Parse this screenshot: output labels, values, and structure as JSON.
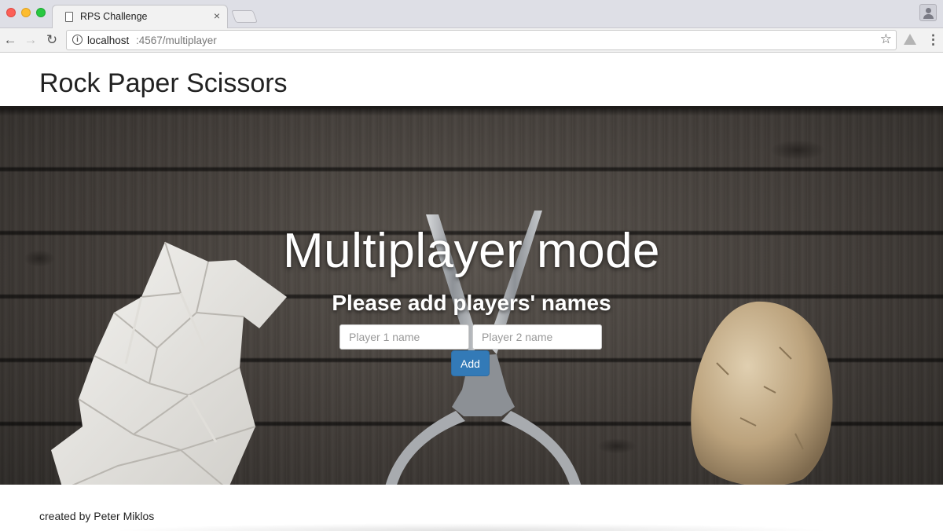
{
  "browser": {
    "tab_title": "RPS Challenge",
    "tab_close": "×",
    "url_host": "localhost",
    "url_path": ":4567/multiplayer",
    "icons": [
      "page-icon",
      "back-icon",
      "forward-icon",
      "reload-icon",
      "info-icon",
      "star-icon",
      "drive-icon",
      "menu-icon",
      "profile-icon"
    ]
  },
  "header": {
    "title": "Rock Paper Scissors"
  },
  "hero": {
    "headline": "Multiplayer mode",
    "subheading": "Please add players' names",
    "player1_placeholder": "Player 1 name",
    "player2_placeholder": "Player 2 name",
    "player1_value": "",
    "player2_value": "",
    "add_label": "Add"
  },
  "footer": {
    "credit": "created by Peter Miklos"
  },
  "colors": {
    "button_primary": "#337ab7",
    "wood": "#3f3a36"
  }
}
